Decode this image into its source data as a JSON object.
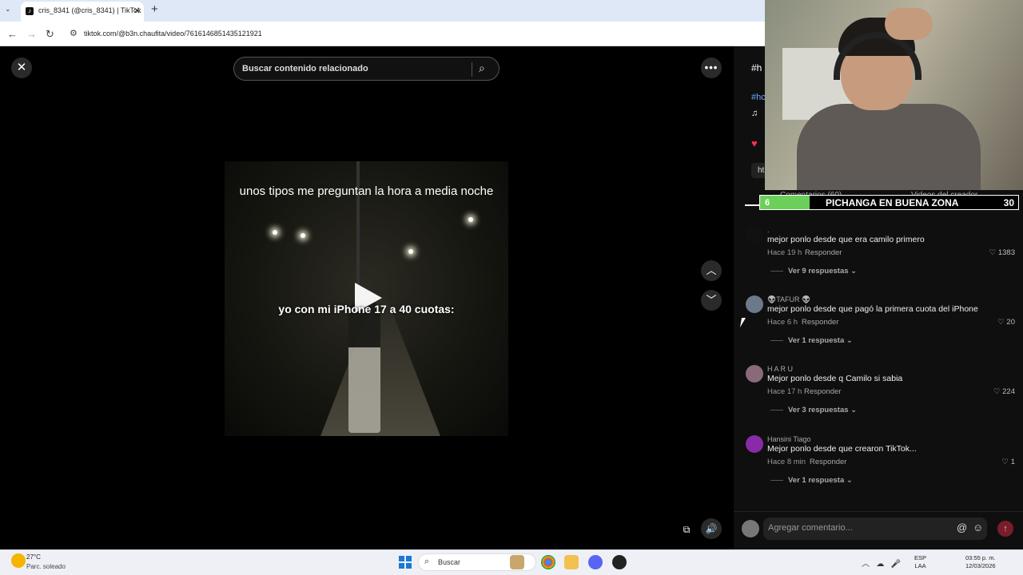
{
  "browser": {
    "tab_title": "cris_8341 (@cris_8341) | TikTok",
    "url": "tiktok.com/@b3n.chaufita/video/7616146851435121921",
    "new_tab": "+",
    "tab_close": "✕"
  },
  "viewer": {
    "search_placeholder": "Buscar contenido relacionado",
    "caption_top": "unos tipos me preguntan la hora a media noche",
    "caption_bottom": "yo con mi iPhone 17 a 40 cuotas:"
  },
  "panel": {
    "header_partial": "#h",
    "hashtag_partial": "#hc",
    "music_partial": "♫",
    "link_partial": "ht",
    "tab_comments": "Comentarios (60)",
    "tab_creator": "Videos del creador",
    "banner": {
      "left": "6",
      "title": "PICHANGA EN BUENA ZONA",
      "right": "30"
    },
    "comments": [
      {
        "user": ".",
        "text": "mejor ponlo desde que era camilo primero",
        "time": "Hace 19 h",
        "reply": "Responder",
        "likes": "1383",
        "view_replies": "Ver 9 respuestas"
      },
      {
        "user": "👽TAFUR 👽",
        "text": "mejor ponlo desde que pagó la primera cuota del iPhone",
        "time": "Hace 6 h",
        "reply": "Responder",
        "likes": "20",
        "view_replies": "Ver 1 respuesta"
      },
      {
        "user": "H A R U",
        "text": "Mejor ponlo desde q Camilo si sabia",
        "time": "Hace 17 h",
        "reply": "Responder",
        "likes": "224",
        "view_replies": "Ver 3 respuestas"
      },
      {
        "user": "Hansini Tiago",
        "text": "Mejor ponlo desde que crearon TikTok...",
        "time": "Hace 8 min",
        "reply": "Responder",
        "likes": "1",
        "view_replies": "Ver 1 respuesta"
      }
    ],
    "compose_placeholder": "Agregar comentario..."
  },
  "taskbar": {
    "weather_temp": "27°C",
    "weather_desc": "Parc. soleado",
    "search_label": "Buscar",
    "lang1": "ESP",
    "lang2": "LAA",
    "time": "03:55 p. m.",
    "date": "12/03/2026"
  },
  "colors": {
    "accent": "#fe2c55",
    "link": "#6fa8ff",
    "banner_green": "#6ccf5a"
  },
  "icons": [
    "close-icon",
    "search-icon",
    "more-icon",
    "chevron-up-icon",
    "chevron-down-icon",
    "volume-icon",
    "pip-icon",
    "heart-icon",
    "at-icon",
    "emoji-icon",
    "send-icon",
    "windows-icon"
  ]
}
